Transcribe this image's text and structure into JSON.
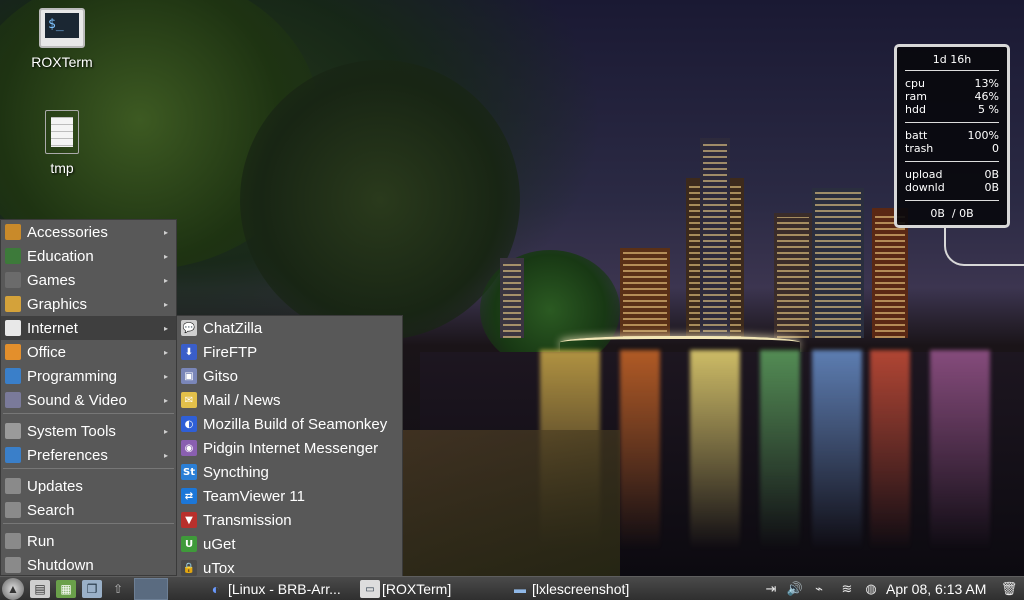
{
  "desktop": {
    "icons": [
      {
        "label": "ROXTerm",
        "icon": "terminal-icon",
        "glyph_text": "$_"
      },
      {
        "label": "tmp",
        "icon": "text-file-icon"
      }
    ]
  },
  "monitor": {
    "uptime": "1d 16h",
    "cpu_label": "cpu",
    "cpu_value": "13%",
    "ram_label": "ram",
    "ram_value": "46%",
    "hdd_label": "hdd",
    "hdd_value": "5 %",
    "batt_label": "batt",
    "batt_value": "100%",
    "trash_label": "trash",
    "trash_value": "0",
    "upload_label": "upload",
    "upload_value": "0B",
    "downld_label": "downld",
    "downld_value": "0B",
    "total_down": "0B",
    "total_sep": "/",
    "total_up": "0B"
  },
  "main_menu": {
    "items": [
      {
        "label": "Accessories",
        "icon": "accessories-icon",
        "color": "#c98a2a",
        "submenu": true
      },
      {
        "label": "Education",
        "icon": "education-icon",
        "color": "#3d7a3a",
        "submenu": true
      },
      {
        "label": "Games",
        "icon": "games-icon",
        "color": "#6b6b6b",
        "submenu": true
      },
      {
        "label": "Graphics",
        "icon": "graphics-icon",
        "color": "#d4a23a",
        "submenu": true
      },
      {
        "label": "Internet",
        "icon": "internet-cloud-icon",
        "color": "#e8e8e8",
        "submenu": true,
        "active": true
      },
      {
        "label": "Office",
        "icon": "office-icon",
        "color": "#e38f2c",
        "submenu": true
      },
      {
        "label": "Programming",
        "icon": "programming-icon",
        "color": "#3a7fc9",
        "submenu": true
      },
      {
        "label": "Sound & Video",
        "icon": "sound-video-icon",
        "color": "#7a7a9a",
        "submenu": true
      },
      {
        "label": "System Tools",
        "icon": "system-tools-gear-icon",
        "color": "#9a9a9a",
        "submenu": true
      },
      {
        "label": "Preferences",
        "icon": "preferences-icon",
        "color": "#3a7fc9",
        "submenu": true
      },
      {
        "label": "Updates",
        "icon": "updates-icon",
        "color": "#8a8a8a",
        "submenu": false
      },
      {
        "label": "Search",
        "icon": "search-icon",
        "color": "#8a8a8a",
        "submenu": false
      },
      {
        "label": "Run",
        "icon": "run-gears-icon",
        "color": "#8a8a8a",
        "submenu": false
      },
      {
        "label": "Shutdown",
        "icon": "power-icon",
        "color": "#8a8a8a",
        "submenu": false
      }
    ]
  },
  "internet_menu": {
    "items": [
      {
        "label": "ChatZilla",
        "icon": "chatzilla-icon",
        "glyph": "💬",
        "color": "#cfcfcf"
      },
      {
        "label": "FireFTP",
        "icon": "fireftp-icon",
        "glyph": "⬇",
        "color": "#3a5ec9"
      },
      {
        "label": "Gitso",
        "icon": "gitso-icon",
        "glyph": "▣",
        "color": "#7a86b8"
      },
      {
        "label": "Mail / News",
        "icon": "mail-news-icon",
        "glyph": "✉",
        "color": "#e3c04a"
      },
      {
        "label": "Mozilla Build of Seamonkey",
        "icon": "seamonkey-icon",
        "glyph": "◐",
        "color": "#2f5fd6"
      },
      {
        "label": "Pidgin Internet Messenger",
        "icon": "pidgin-icon",
        "glyph": "◉",
        "color": "#8a5fb0"
      },
      {
        "label": "Syncthing",
        "icon": "syncthing-icon",
        "glyph": "St",
        "color": "#2b7fd6"
      },
      {
        "label": "TeamViewer 11",
        "icon": "teamviewer-icon",
        "glyph": "⇄",
        "color": "#1c77d8"
      },
      {
        "label": "Transmission",
        "icon": "transmission-icon",
        "glyph": "▼",
        "color": "#b8302c"
      },
      {
        "label": "uGet",
        "icon": "uget-icon",
        "glyph": "U",
        "color": "#3f9a3a"
      },
      {
        "label": "uTox",
        "icon": "utox-lock-icon",
        "glyph": "🔒",
        "color": "#4a4a4a"
      }
    ]
  },
  "taskbar": {
    "tasks": [
      {
        "label": "[Linux - BRB-Arr...",
        "icon": "seamonkey-icon"
      },
      {
        "label": "[ROXTerm]",
        "icon": "terminal-icon"
      },
      {
        "label": "[lxlescreenshot]",
        "icon": "folder-icon"
      }
    ],
    "clock": "Apr 08,  6:13 AM"
  }
}
